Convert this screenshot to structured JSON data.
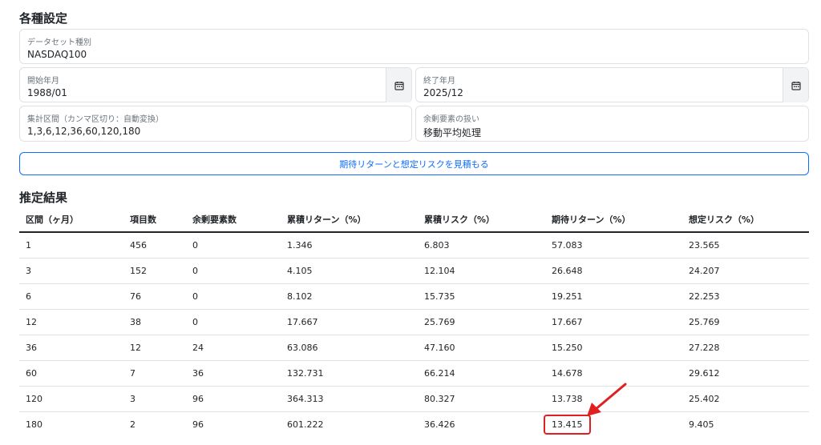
{
  "settings": {
    "heading": "各種設定",
    "dataset": {
      "label": "データセット種別",
      "value": "NASDAQ100"
    },
    "start": {
      "label": "開始年月",
      "value": "1988/01",
      "icon": "calendar-icon"
    },
    "end": {
      "label": "終了年月",
      "value": "2025/12",
      "icon": "calendar-icon"
    },
    "intervals": {
      "label": "集計区間（カンマ区切り：自動変換）",
      "value": "1,3,6,12,36,60,120,180"
    },
    "remainder": {
      "label": "余剰要素の扱い",
      "value": "移動平均処理"
    },
    "estimate_button": "期待リターンと想定リスクを見積もる"
  },
  "results": {
    "heading": "推定結果",
    "columns": [
      "区間（ヶ月）",
      "項目数",
      "余剰要素数",
      "累積リターン（%）",
      "累積リスク（%）",
      "期待リターン（%）",
      "想定リスク（%）"
    ],
    "rows": [
      [
        "1",
        "456",
        "0",
        "1.346",
        "6.803",
        "57.083",
        "23.565"
      ],
      [
        "3",
        "152",
        "0",
        "4.105",
        "12.104",
        "26.648",
        "24.207"
      ],
      [
        "6",
        "76",
        "0",
        "8.102",
        "15.735",
        "19.251",
        "22.253"
      ],
      [
        "12",
        "38",
        "0",
        "17.667",
        "25.769",
        "17.667",
        "25.769"
      ],
      [
        "36",
        "12",
        "24",
        "63.086",
        "47.160",
        "15.250",
        "27.228"
      ],
      [
        "60",
        "7",
        "36",
        "132.731",
        "66.214",
        "14.678",
        "29.612"
      ],
      [
        "120",
        "3",
        "96",
        "364.313",
        "80.327",
        "13.738",
        "25.402"
      ],
      [
        "180",
        "2",
        "96",
        "601.222",
        "36.426",
        "13.415",
        "9.405"
      ]
    ]
  },
  "colors": {
    "accent": "#0d6efd",
    "highlight": "#e02020",
    "border": "#dee2e6"
  }
}
